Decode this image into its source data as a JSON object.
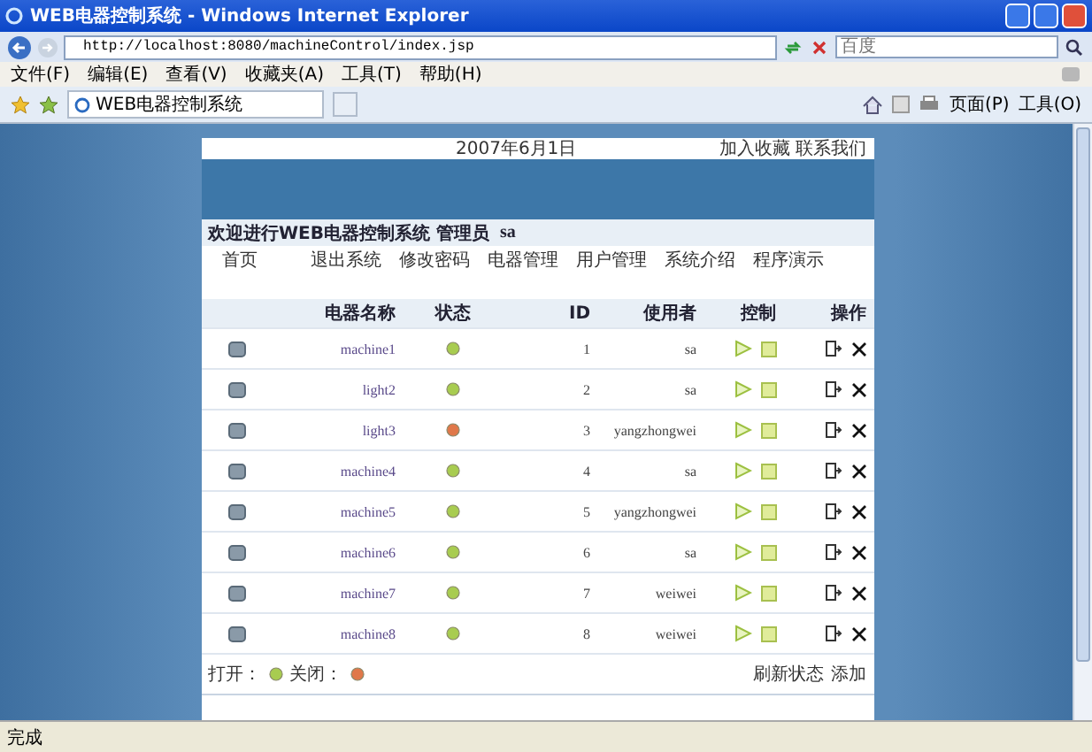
{
  "window": {
    "title": "WEB电器控制系统 - Windows Internet Explorer"
  },
  "address_bar": {
    "url": "http://localhost:8080/machineControl/index.jsp",
    "search_placeholder": "百度"
  },
  "menu": [
    "文件(F)",
    "编辑(E)",
    "查看(V)",
    "收藏夹(A)",
    "工具(T)",
    "帮助(H)"
  ],
  "tab": {
    "label": "WEB电器控制系统"
  },
  "toolbar": [
    "页面(P)",
    "工具(O)"
  ],
  "page": {
    "date": "2007年6月1日",
    "top_links": [
      "加入收藏",
      "联系我们"
    ],
    "welcome": "欢迎进行WEB电器控制系统  管理员",
    "user": "sa",
    "nav": [
      "首页",
      "退出系统",
      "修改密码",
      "电器管理",
      "用户管理",
      "系统介绍",
      "程序演示"
    ],
    "columns": [
      "电器名称",
      "状态",
      "ID",
      "使用者",
      "控制",
      "操作"
    ],
    "rows": [
      {
        "name": "machine1",
        "on": true,
        "id": "1",
        "user": "sa"
      },
      {
        "name": "light2",
        "on": true,
        "id": "2",
        "user": "sa"
      },
      {
        "name": "light3",
        "on": false,
        "id": "3",
        "user": "yangzhongwei"
      },
      {
        "name": "machine4",
        "on": true,
        "id": "4",
        "user": "sa"
      },
      {
        "name": "machine5",
        "on": true,
        "id": "5",
        "user": "yangzhongwei"
      },
      {
        "name": "machine6",
        "on": true,
        "id": "6",
        "user": "sa"
      },
      {
        "name": "machine7",
        "on": true,
        "id": "7",
        "user": "weiwei"
      },
      {
        "name": "machine8",
        "on": true,
        "id": "8",
        "user": "weiwei"
      }
    ],
    "legend": [
      {
        "label": "打开：",
        "on": true
      },
      {
        "label": "关闭：",
        "on": false
      }
    ],
    "footer_links": [
      "刷新状态",
      "添加"
    ]
  },
  "status_bar": {
    "text": "完成"
  }
}
